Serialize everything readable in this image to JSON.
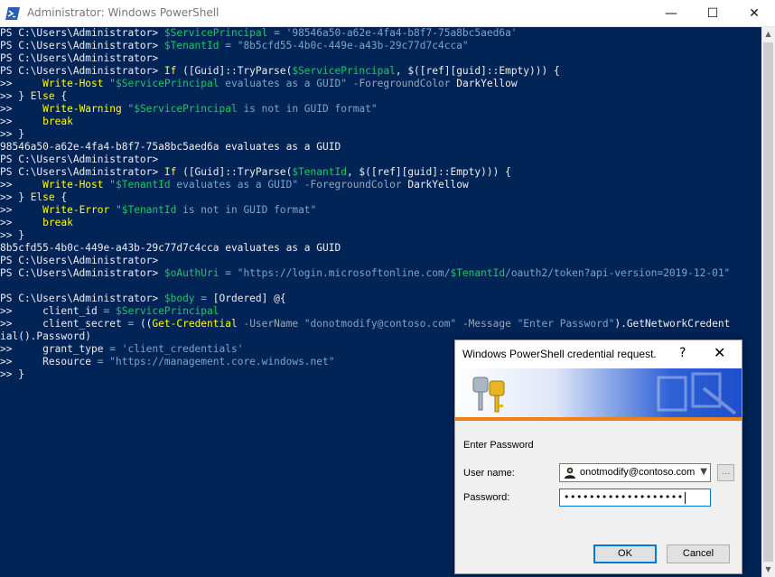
{
  "window": {
    "title": "Administrator: Windows PowerShell",
    "minimize": "—",
    "maximize": "☐",
    "close": "✕"
  },
  "console": {
    "lines": [
      [
        [
          "w",
          "PS C:\\Users\\Administrator> "
        ],
        [
          "g",
          "$ServicePrincipal"
        ],
        [
          "p",
          " = "
        ],
        [
          "s",
          "'98546a50-a62e-4fa4-b8f7-75a8bc5aed6a'"
        ]
      ],
      [
        [
          "w",
          "PS C:\\Users\\Administrator> "
        ],
        [
          "g",
          "$TenantId"
        ],
        [
          "p",
          " = "
        ],
        [
          "s",
          "\"8b5cfd55-4b0c-449e-a43b-29c77d7c4cca\""
        ]
      ],
      [
        [
          "w",
          "PS C:\\Users\\Administrator>"
        ]
      ],
      [
        [
          "w",
          "PS C:\\Users\\Administrator> "
        ],
        [
          "y",
          "If"
        ],
        [
          "w",
          " ([Guid]::TryParse("
        ],
        [
          "g",
          "$ServicePrincipal"
        ],
        [
          "w",
          ", $([ref][guid]::Empty))) {"
        ]
      ],
      [
        [
          "w",
          ">>     "
        ],
        [
          "y",
          "Write-Host"
        ],
        [
          "s",
          " \""
        ],
        [
          "g",
          "$ServicePrincipal"
        ],
        [
          "s",
          " evaluates as a GUID\""
        ],
        [
          "p",
          " -ForegroundColor"
        ],
        [
          "w",
          " DarkYellow"
        ]
      ],
      [
        [
          "w",
          ">> } "
        ],
        [
          "y",
          "Else"
        ],
        [
          "w",
          " {"
        ]
      ],
      [
        [
          "w",
          ">>     "
        ],
        [
          "y",
          "Write-Warning"
        ],
        [
          "s",
          " \""
        ],
        [
          "g",
          "$ServicePrincipal"
        ],
        [
          "s",
          " is not in GUID format\""
        ]
      ],
      [
        [
          "w",
          ">>     "
        ],
        [
          "y",
          "break"
        ]
      ],
      [
        [
          "w",
          ">> }"
        ]
      ],
      [
        [
          "o",
          "98546a50-a62e-4fa4-b8f7-75a8bc5aed6a evaluates as a GUID"
        ]
      ],
      [
        [
          "w",
          "PS C:\\Users\\Administrator>"
        ]
      ],
      [
        [
          "w",
          "PS C:\\Users\\Administrator> "
        ],
        [
          "y",
          "If"
        ],
        [
          "w",
          " ([Guid]::TryParse("
        ],
        [
          "g",
          "$TenantId"
        ],
        [
          "w",
          ", $([ref][guid]::Empty))) {"
        ]
      ],
      [
        [
          "w",
          ">>     "
        ],
        [
          "y",
          "Write-Host"
        ],
        [
          "s",
          " \""
        ],
        [
          "g",
          "$TenantId"
        ],
        [
          "s",
          " evaluates as a GUID\""
        ],
        [
          "p",
          " -ForegroundColor"
        ],
        [
          "w",
          " DarkYellow"
        ]
      ],
      [
        [
          "w",
          ">> } "
        ],
        [
          "y",
          "Else"
        ],
        [
          "w",
          " {"
        ]
      ],
      [
        [
          "w",
          ">>     "
        ],
        [
          "y",
          "Write-Error"
        ],
        [
          "s",
          " \""
        ],
        [
          "g",
          "$TenantId"
        ],
        [
          "s",
          " is not in GUID format\""
        ]
      ],
      [
        [
          "w",
          ">>     "
        ],
        [
          "y",
          "break"
        ]
      ],
      [
        [
          "w",
          ">> }"
        ]
      ],
      [
        [
          "o",
          "8b5cfd55-4b0c-449e-a43b-29c77d7c4cca evaluates as a GUID"
        ]
      ],
      [
        [
          "w",
          "PS C:\\Users\\Administrator>"
        ]
      ],
      [
        [
          "w",
          "PS C:\\Users\\Administrator> "
        ],
        [
          "g",
          "$oAuthUri"
        ],
        [
          "p",
          " = "
        ],
        [
          "s",
          "\"https://login.microsoftonline.com/"
        ],
        [
          "g",
          "$TenantId"
        ],
        [
          "s",
          "/oauth2/token?api-version=2019-12-01\""
        ]
      ],
      [],
      [
        [
          "w",
          "PS C:\\Users\\Administrator> "
        ],
        [
          "g",
          "$body"
        ],
        [
          "p",
          " = "
        ],
        [
          "w",
          "[Ordered] @{"
        ]
      ],
      [
        [
          "w",
          ">>     client_id "
        ],
        [
          "p",
          "= "
        ],
        [
          "g",
          "$ServicePrincipal"
        ]
      ],
      [
        [
          "w",
          ">>     client_secret "
        ],
        [
          "p",
          "= "
        ],
        [
          "w",
          "(("
        ],
        [
          "y",
          "Get-Credential"
        ],
        [
          "p",
          " -UserName"
        ],
        [
          "s",
          " \"donotmodify@contoso.com\""
        ],
        [
          "p",
          " -Message"
        ],
        [
          "s",
          " \"Enter Password\""
        ],
        [
          "w",
          ").GetNetworkCredent"
        ]
      ],
      [
        [
          "w",
          "ial().Password)"
        ]
      ],
      [
        [
          "w",
          ">>     grant_type "
        ],
        [
          "p",
          "= "
        ],
        [
          "s",
          "'client_credentials'"
        ]
      ],
      [
        [
          "w",
          ">>     Resource "
        ],
        [
          "p",
          "= "
        ],
        [
          "s",
          "\"https://management.core.windows.net\""
        ]
      ],
      [
        [
          "w",
          ">> }"
        ]
      ]
    ]
  },
  "dialog": {
    "title": "Windows PowerShell credential request.",
    "help": "?",
    "close": "✕",
    "message": "Enter Password",
    "username_label": "User name:",
    "username_value": "onotmodify@contoso.com",
    "password_label": "Password:",
    "password_value": "•••••••••••••••••••",
    "ok_label": "OK",
    "cancel_label": "Cancel",
    "browse_label": "..."
  }
}
